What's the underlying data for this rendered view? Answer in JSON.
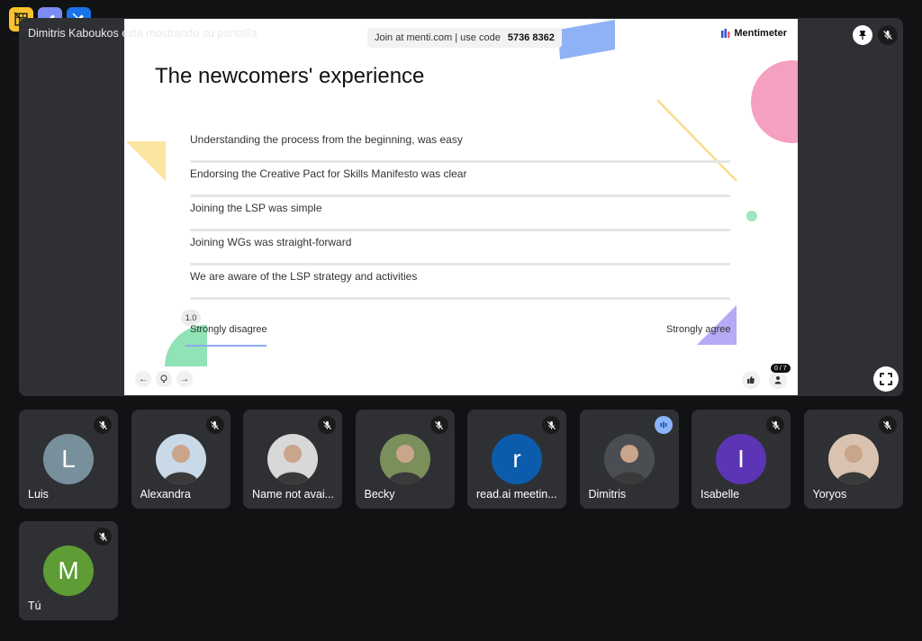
{
  "stage": {
    "presenter_caption": "Dimitris Kaboukos está mostrando su pantalla"
  },
  "slide": {
    "join_text": "Join at menti.com | use code",
    "join_code": "5736 8362",
    "brand": "Mentimeter",
    "title": "The newcomers' experience",
    "statements": [
      "Understanding the process from the beginning, was easy",
      "Endorsing the Creative Pact for Skills Manifesto was clear",
      "Joining the LSP was simple",
      "Joining WGs was straight-forward",
      "We are aware of the LSP strategy and activities"
    ],
    "scale_value": "1.0",
    "scale_min_label": "Strongly disagree",
    "scale_max_label": "Strongly agree",
    "audience_count": "0 / 7"
  },
  "participants": [
    {
      "name": "Luis",
      "initial": "L",
      "color": "#78909c",
      "mic": "muted"
    },
    {
      "name": "Alexandra",
      "initial": "",
      "color": "#c9d9e8",
      "mic": "muted",
      "photo": true
    },
    {
      "name": "Name not avai...",
      "initial": "",
      "color": "#d8d8d8",
      "mic": "muted",
      "photo": true
    },
    {
      "name": "Becky",
      "initial": "",
      "color": "#7a8f5a",
      "mic": "muted",
      "photo": true
    },
    {
      "name": "read.ai meetin...",
      "initial": "r",
      "color": "#0b5cad",
      "mic": "muted"
    },
    {
      "name": "Dimitris",
      "initial": "",
      "color": "#4a4d52",
      "mic": "speaking",
      "photo": true
    },
    {
      "name": "Isabelle",
      "initial": "I",
      "color": "#5b35b5",
      "mic": "muted"
    },
    {
      "name": "Yoryos",
      "initial": "",
      "color": "#d9c3b0",
      "mic": "muted",
      "photo": true
    },
    {
      "name": "Tú",
      "initial": "M",
      "color": "#5e9c35",
      "mic": "muted"
    }
  ]
}
